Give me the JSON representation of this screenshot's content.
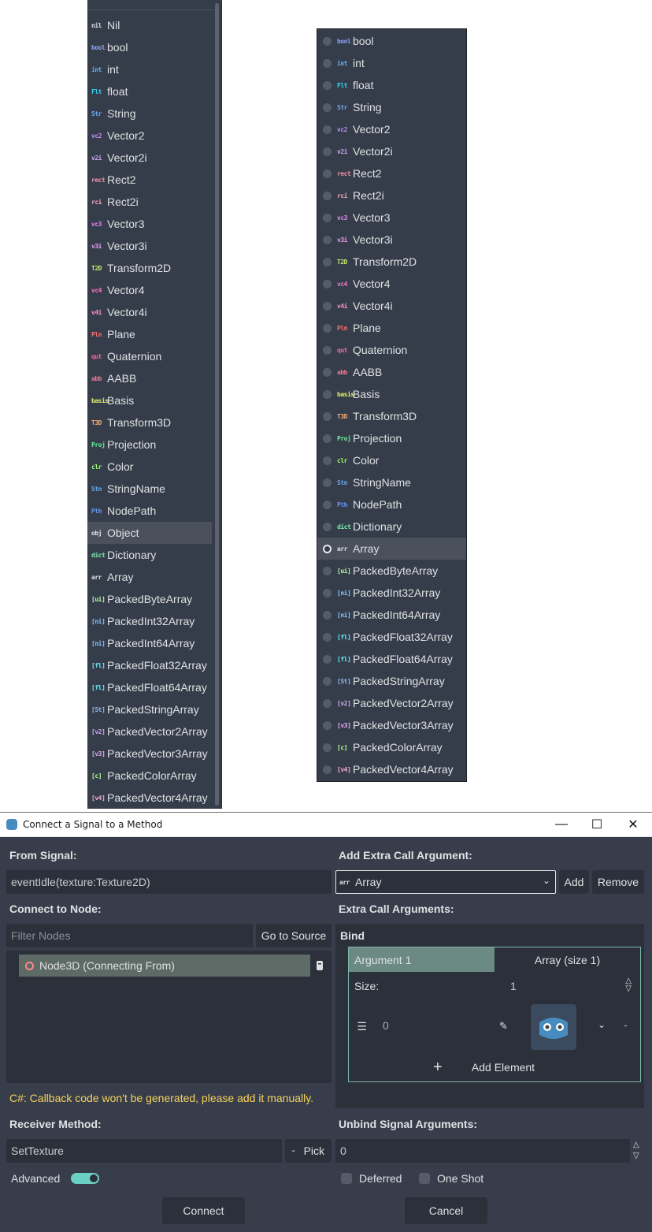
{
  "types": [
    {
      "tag": "nil",
      "label": "Nil",
      "color": "#dfe1e4"
    },
    {
      "tag": "bool",
      "label": "bool",
      "color": "#8da5f3"
    },
    {
      "tag": "int",
      "label": "int",
      "color": "#5fb2ff"
    },
    {
      "tag": "Flt",
      "label": "float",
      "color": "#35d4f4"
    },
    {
      "tag": "Str",
      "label": "String",
      "color": "#6ba7ec"
    },
    {
      "tag": "vc2",
      "label": "Vector2",
      "color": "#bd91f1"
    },
    {
      "tag": "v2i",
      "label": "Vector2i",
      "color": "#c7a6f3"
    },
    {
      "tag": "rect",
      "label": "Rect2",
      "color": "#f191a5"
    },
    {
      "tag": "rci",
      "label": "Rect2i",
      "color": "#f5a5b8"
    },
    {
      "tag": "vc3",
      "label": "Vector3",
      "color": "#e286f0"
    },
    {
      "tag": "v3i",
      "label": "Vector3i",
      "color": "#e69cf2"
    },
    {
      "tag": "T2D",
      "label": "Transform2D",
      "color": "#c4ec69"
    },
    {
      "tag": "vc4",
      "label": "Vector4",
      "color": "#f27ac4"
    },
    {
      "tag": "v4i",
      "label": "Vector4i",
      "color": "#f490d0"
    },
    {
      "tag": "Pln",
      "label": "Plane",
      "color": "#f77070"
    },
    {
      "tag": "qut",
      "label": "Quaternion",
      "color": "#ec69a3"
    },
    {
      "tag": "abb",
      "label": "AABB",
      "color": "#ee7991"
    },
    {
      "tag": "basis",
      "label": "Basis",
      "color": "#e3ec69"
    },
    {
      "tag": "T3D",
      "label": "Transform3D",
      "color": "#f6a86e"
    },
    {
      "tag": "Proj",
      "label": "Projection",
      "color": "#69ec9a"
    },
    {
      "tag": "clr",
      "label": "Color",
      "color": "#9dff70"
    },
    {
      "tag": "Stn",
      "label": "StringName",
      "color": "#6ba7ec"
    },
    {
      "tag": "Pth",
      "label": "NodePath",
      "color": "#6993ec"
    },
    {
      "tag": "obj",
      "label": "Object",
      "color": "#dfe1e4"
    },
    {
      "tag": "dict",
      "label": "Dictionary",
      "color": "#77edb1"
    },
    {
      "tag": "arr",
      "label": "Array",
      "color": "#e0e0e0"
    },
    {
      "tag": "[ui]",
      "label": "PackedByteArray",
      "color": "#b9f3a4"
    },
    {
      "tag": "[ni]",
      "label": "PackedInt32Array",
      "color": "#82c2ff"
    },
    {
      "tag": "[ni]",
      "label": "PackedInt64Array",
      "color": "#82c2ff"
    },
    {
      "tag": "[fl]",
      "label": "PackedFloat32Array",
      "color": "#68e5f8"
    },
    {
      "tag": "[fl]",
      "label": "PackedFloat64Array",
      "color": "#68e5f8"
    },
    {
      "tag": "[St]",
      "label": "PackedStringArray",
      "color": "#8eb9ed"
    },
    {
      "tag": "[v2]",
      "label": "PackedVector2Array",
      "color": "#cdaaf3"
    },
    {
      "tag": "[v3]",
      "label": "PackedVector3Array",
      "color": "#e6a6f5"
    },
    {
      "tag": "[c]",
      "label": "PackedColorArray",
      "color": "#b6ff8f"
    },
    {
      "tag": "[v4]",
      "label": "PackedVector4Array",
      "color": "#f7a5d4"
    }
  ],
  "left_list": {
    "selected": "Object"
  },
  "right_list": {
    "selected": "Array"
  },
  "dialog": {
    "title": "Connect a Signal to a Method",
    "from_signal_label": "From Signal:",
    "from_signal_value": "eventIdle(texture:Texture2D)",
    "connect_to_node_label": "Connect to Node:",
    "filter_placeholder": "Filter Nodes",
    "go_to_source": "Go to Source",
    "node_item": "Node3D (Connecting From)",
    "warning": "C#: Callback code won't be generated, please add it manually.",
    "receiver_method_label": "Receiver Method:",
    "receiver_method_value": "SetTexture",
    "pick": "Pick",
    "advanced": "Advanced",
    "add_extra_label": "Add Extra Call Argument:",
    "extra_type_tag": "arr",
    "extra_type_value": "Array",
    "add": "Add",
    "remove": "Remove",
    "extra_args_label": "Extra Call Arguments:",
    "bind": "Bind",
    "arg_name": "Argument 1",
    "arg_value": "Array (size 1)",
    "size_label": "Size:",
    "size_value": "1",
    "element_index": "0",
    "add_element": "Add Element",
    "unbind_label": "Unbind Signal Arguments:",
    "unbind_value": "0",
    "deferred": "Deferred",
    "one_shot": "One Shot",
    "connect": "Connect",
    "cancel": "Cancel"
  }
}
